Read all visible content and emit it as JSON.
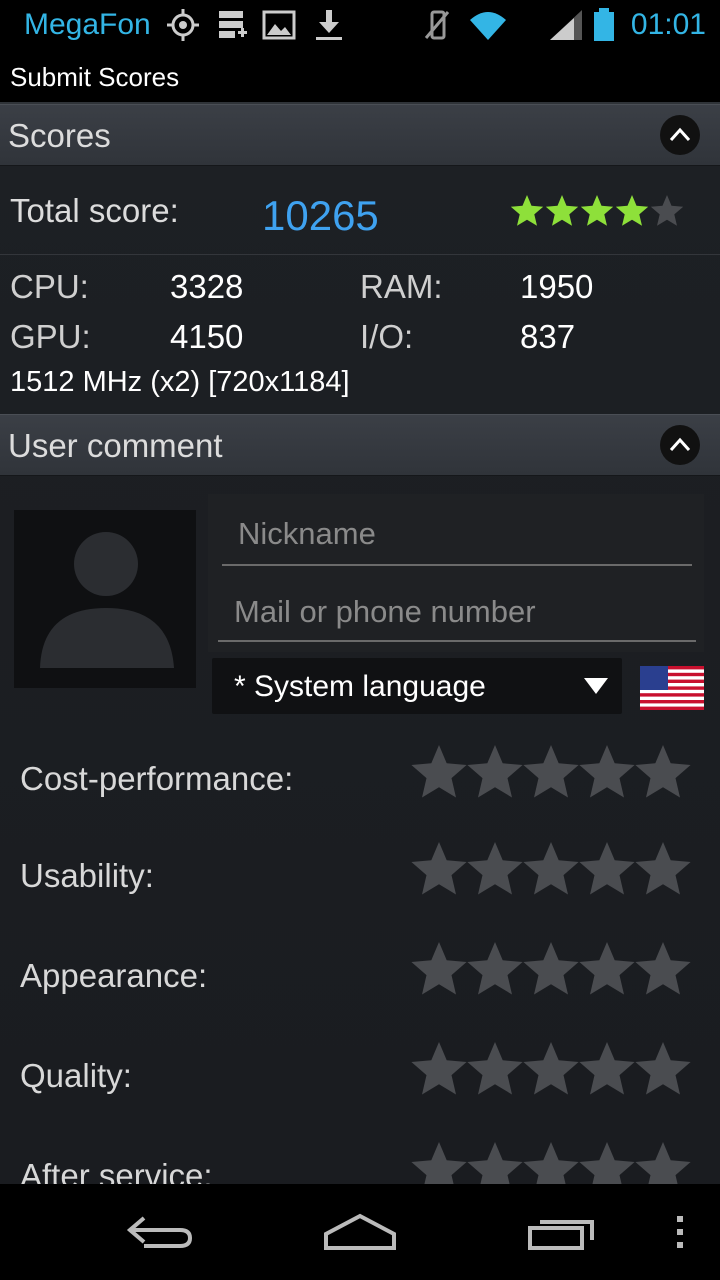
{
  "status_bar": {
    "carrier": "MegaFon",
    "time": "01:01",
    "icons": [
      "gps-icon",
      "storage-icon",
      "image-icon",
      "download-icon",
      "mute-icon",
      "wifi-icon",
      "signal-icon",
      "battery-icon"
    ]
  },
  "app": {
    "title": "Submit Scores"
  },
  "scores_section": {
    "header": "Scores",
    "total_label": "Total score:",
    "total_value": "10265",
    "total_stars": 4,
    "total_stars_max": 5,
    "cpu_label": "CPU:",
    "cpu_value": "3328",
    "ram_label": "RAM:",
    "ram_value": "1950",
    "gpu_label": "GPU:",
    "gpu_value": "4150",
    "io_label": "I/O:",
    "io_value": "837",
    "device_info": "1512 MHz (x2) [720x1184]"
  },
  "comment_section": {
    "header": "User comment",
    "nickname_placeholder": "Nickname",
    "contact_placeholder": "Mail or phone number",
    "language_value": "* System language",
    "ratings": [
      {
        "label": "Cost-performance:",
        "stars": 0
      },
      {
        "label": "Usability:",
        "stars": 0
      },
      {
        "label": "Appearance:",
        "stars": 0
      },
      {
        "label": "Quality:",
        "stars": 0
      },
      {
        "label": "After service:",
        "stars": 0
      }
    ]
  },
  "colors": {
    "accent": "#33b5e5",
    "score_blue": "#3fa2f0",
    "star_green": "#8ee03a",
    "star_gray": "#4a4c50"
  }
}
